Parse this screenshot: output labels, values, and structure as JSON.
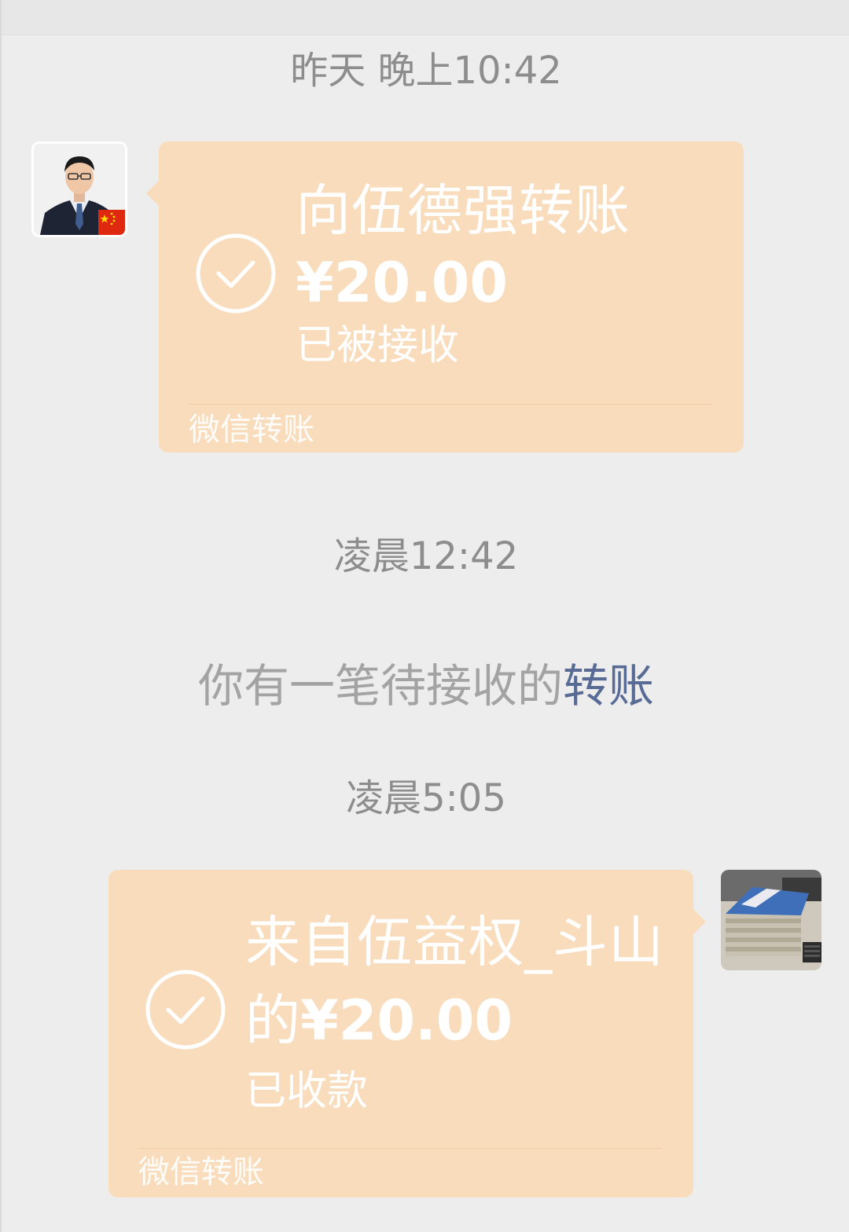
{
  "chat": {
    "timestamp_1": "昨天 晚上10:42",
    "timestamp_2": "凌晨12:42",
    "timestamp_3": "凌晨5:05",
    "system_message": {
      "prefix": "你有一笔待接收的",
      "link": "转账"
    },
    "transfer_sent": {
      "title": "向伍德强转账",
      "amount": "¥20.00",
      "status": "已被接收",
      "footer": "微信转账",
      "icon": "check-circle-icon"
    },
    "transfer_received": {
      "title_line1": "来自伍益权_斗山",
      "title_line2_prefix": "的",
      "amount": "¥20.00",
      "status": "已收款",
      "footer": "微信转账",
      "icon": "check-circle-icon"
    }
  },
  "colors": {
    "background": "#ededed",
    "bubble": "#f9dcbb",
    "timestamp": "#8d8d8d",
    "system_text": "#a3a3a3",
    "link": "#576b95"
  }
}
